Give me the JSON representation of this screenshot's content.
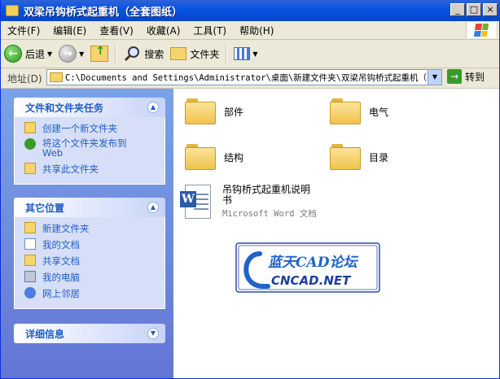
{
  "window": {
    "title": "双梁吊钩桥式起重机（全套图纸）"
  },
  "menu": [
    "文件(F)",
    "编辑(E)",
    "查看(V)",
    "收藏(A)",
    "工具(T)",
    "帮助(H)"
  ],
  "toolbar": {
    "back": "后退",
    "search": "搜索",
    "folders": "文件夹"
  },
  "address": {
    "label": "地址(D)",
    "path": "C:\\Documents and Settings\\Administrator\\桌面\\新建文件夹\\双梁吊钩桥式起重机（",
    "go": "转到"
  },
  "tasks": {
    "title": "文件和文件夹任务",
    "items": [
      "创建一个新文件夹",
      "将这个文件夹发布到\nWeb",
      "共享此文件夹"
    ]
  },
  "places": {
    "title": "其它位置",
    "items": [
      "新建文件夹",
      "我的文档",
      "共享文档",
      "我的电脑",
      "网上邻居"
    ]
  },
  "details": {
    "title": "详细信息"
  },
  "files": [
    {
      "name": "部件",
      "type": "folder"
    },
    {
      "name": "电气",
      "type": "folder"
    },
    {
      "name": "结构",
      "type": "folder"
    },
    {
      "name": "目录",
      "type": "folder"
    },
    {
      "name": "吊钩桥式起重机说明书",
      "type": "Microsoft Word 文档"
    }
  ],
  "watermark": {
    "top": "蓝天CAD论坛",
    "bottom": "CNCAD.NET"
  },
  "colors": {
    "titlebar": "#0a54e3",
    "pane": "#6375d6",
    "link": "#215dc6"
  }
}
